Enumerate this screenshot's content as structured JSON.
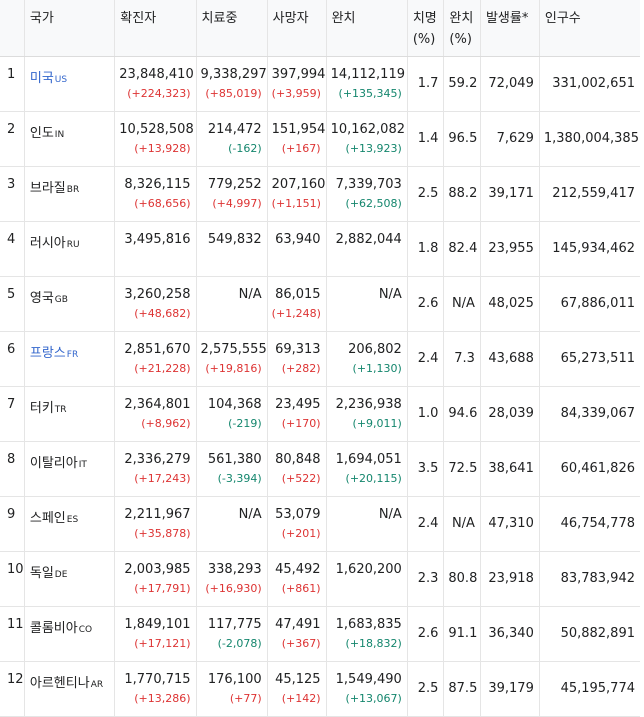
{
  "headers": {
    "country": "국가",
    "confirmed": "확진자",
    "active": "치료중",
    "deaths": "사망자",
    "recovered": "완치",
    "cfr_line1": "치명",
    "cfr_line2": "(%)",
    "rr_line1": "완치",
    "rr_line2": "(%)",
    "incidence": "발생률*",
    "population": "인구수"
  },
  "colors": {
    "increase": "#dd3333",
    "decrease": "#14866d",
    "link": "#3366cc"
  },
  "rows": [
    {
      "rank": "1",
      "name": "미국",
      "code": "US",
      "link": true,
      "confirmed": "23,848,410",
      "confirmed_delta": "(+224,323)",
      "active": "9,338,297",
      "active_delta": "(+85,019)",
      "active_dir": "up",
      "deaths": "397,994",
      "deaths_delta": "(+3,959)",
      "recovered": "14,112,119",
      "recovered_delta": "(+135,345)",
      "cfr": "1.7",
      "rr": "59.2",
      "incidence": "72,049",
      "population": "331,002,651"
    },
    {
      "rank": "2",
      "name": "인도",
      "code": "IN",
      "link": false,
      "confirmed": "10,528,508",
      "confirmed_delta": "(+13,928)",
      "active": "214,472",
      "active_delta": "(-162)",
      "active_dir": "down",
      "deaths": "151,954",
      "deaths_delta": "(+167)",
      "recovered": "10,162,082",
      "recovered_delta": "(+13,923)",
      "cfr": "1.4",
      "rr": "96.5",
      "incidence": "7,629",
      "population": "1,380,004,385"
    },
    {
      "rank": "3",
      "name": "브라질",
      "code": "BR",
      "link": false,
      "confirmed": "8,326,115",
      "confirmed_delta": "(+68,656)",
      "active": "779,252",
      "active_delta": "(+4,997)",
      "active_dir": "up",
      "deaths": "207,160",
      "deaths_delta": "(+1,151)",
      "recovered": "7,339,703",
      "recovered_delta": "(+62,508)",
      "cfr": "2.5",
      "rr": "88.2",
      "incidence": "39,171",
      "population": "212,559,417"
    },
    {
      "rank": "4",
      "name": "러시아",
      "code": "RU",
      "link": false,
      "confirmed": "3,495,816",
      "confirmed_delta": "",
      "active": "549,832",
      "active_delta": "",
      "active_dir": "",
      "deaths": "63,940",
      "deaths_delta": "",
      "recovered": "2,882,044",
      "recovered_delta": "",
      "cfr": "1.8",
      "rr": "82.4",
      "incidence": "23,955",
      "population": "145,934,462"
    },
    {
      "rank": "5",
      "name": "영국",
      "code": "GB",
      "link": false,
      "confirmed": "3,260,258",
      "confirmed_delta": "(+48,682)",
      "active": "N/A",
      "active_delta": "",
      "active_dir": "",
      "deaths": "86,015",
      "deaths_delta": "(+1,248)",
      "recovered": "N/A",
      "recovered_delta": "",
      "cfr": "2.6",
      "rr": "N/A",
      "incidence": "48,025",
      "population": "67,886,011"
    },
    {
      "rank": "6",
      "name": "프랑스",
      "code": "FR",
      "link": true,
      "confirmed": "2,851,670",
      "confirmed_delta": "(+21,228)",
      "active": "2,575,555",
      "active_delta": "(+19,816)",
      "active_dir": "up",
      "deaths": "69,313",
      "deaths_delta": "(+282)",
      "recovered": "206,802",
      "recovered_delta": "(+1,130)",
      "cfr": "2.4",
      "rr": "7.3",
      "incidence": "43,688",
      "population": "65,273,511"
    },
    {
      "rank": "7",
      "name": "터키",
      "code": "TR",
      "link": false,
      "confirmed": "2,364,801",
      "confirmed_delta": "(+8,962)",
      "active": "104,368",
      "active_delta": "(-219)",
      "active_dir": "down",
      "deaths": "23,495",
      "deaths_delta": "(+170)",
      "recovered": "2,236,938",
      "recovered_delta": "(+9,011)",
      "cfr": "1.0",
      "rr": "94.6",
      "incidence": "28,039",
      "population": "84,339,067"
    },
    {
      "rank": "8",
      "name": "이탈리아",
      "code": "IT",
      "link": false,
      "confirmed": "2,336,279",
      "confirmed_delta": "(+17,243)",
      "active": "561,380",
      "active_delta": "(-3,394)",
      "active_dir": "down",
      "deaths": "80,848",
      "deaths_delta": "(+522)",
      "recovered": "1,694,051",
      "recovered_delta": "(+20,115)",
      "cfr": "3.5",
      "rr": "72.5",
      "incidence": "38,641",
      "population": "60,461,826"
    },
    {
      "rank": "9",
      "name": "스페인",
      "code": "ES",
      "link": false,
      "confirmed": "2,211,967",
      "confirmed_delta": "(+35,878)",
      "active": "N/A",
      "active_delta": "",
      "active_dir": "",
      "deaths": "53,079",
      "deaths_delta": "(+201)",
      "recovered": "N/A",
      "recovered_delta": "",
      "cfr": "2.4",
      "rr": "N/A",
      "incidence": "47,310",
      "population": "46,754,778"
    },
    {
      "rank": "10",
      "name": "독일",
      "code": "DE",
      "link": false,
      "confirmed": "2,003,985",
      "confirmed_delta": "(+17,791)",
      "active": "338,293",
      "active_delta": "(+16,930)",
      "active_dir": "up",
      "deaths": "45,492",
      "deaths_delta": "(+861)",
      "recovered": "1,620,200",
      "recovered_delta": "",
      "cfr": "2.3",
      "rr": "80.8",
      "incidence": "23,918",
      "population": "83,783,942"
    },
    {
      "rank": "11",
      "name": "콜롬비아",
      "code": "CO",
      "link": false,
      "confirmed": "1,849,101",
      "confirmed_delta": "(+17,121)",
      "active": "117,775",
      "active_delta": "(-2,078)",
      "active_dir": "down",
      "deaths": "47,491",
      "deaths_delta": "(+367)",
      "recovered": "1,683,835",
      "recovered_delta": "(+18,832)",
      "cfr": "2.6",
      "rr": "91.1",
      "incidence": "36,340",
      "population": "50,882,891"
    },
    {
      "rank": "12",
      "name": "아르헨티나",
      "code": "AR",
      "link": false,
      "confirmed": "1,770,715",
      "confirmed_delta": "(+13,286)",
      "active": "176,100",
      "active_delta": "(+77)",
      "active_dir": "up",
      "deaths": "45,125",
      "deaths_delta": "(+142)",
      "recovered": "1,549,490",
      "recovered_delta": "(+13,067)",
      "cfr": "2.5",
      "rr": "87.5",
      "incidence": "39,179",
      "population": "45,195,774"
    }
  ]
}
